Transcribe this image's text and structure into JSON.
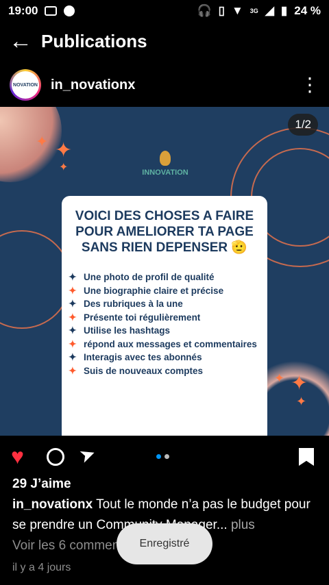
{
  "status_bar": {
    "time": "19:00",
    "battery": "24 %",
    "network": "3G"
  },
  "header": {
    "title": "Publications"
  },
  "post": {
    "author": "in_novationx",
    "avatar_text": "NOVATION",
    "counter": "1/2",
    "logo_text": "INNOVATION",
    "card": {
      "title": "VOICI DES CHOSES A FAIRE POUR AMELIORER TA PAGE SANS RIEN DEPENSER 🫡",
      "items": [
        "Une photo de profil de qualité",
        "Une biographie claire et précise",
        "Des rubriques à la une",
        "Présente toi régulièrement",
        "Utilise les hashtags",
        "répond aux messages et commentaires",
        "Interagis avec tes abonnés",
        "Suis de nouveaux comptes"
      ]
    },
    "likes": "29 J’aime",
    "caption_text": "Tout le monde n’a pas le budget pour se prendre un Community  Manager...",
    "more": "plus",
    "view_comments": "Voir les 6 commentaires",
    "time": "il y a 4 jours"
  },
  "toast": "Enregistré",
  "colors": {
    "background": "#000000",
    "post_bg": "#1f3e61",
    "heart": "#ff3040",
    "accent_orange": "#ff5b2d",
    "dot_active": "#0095f6"
  }
}
